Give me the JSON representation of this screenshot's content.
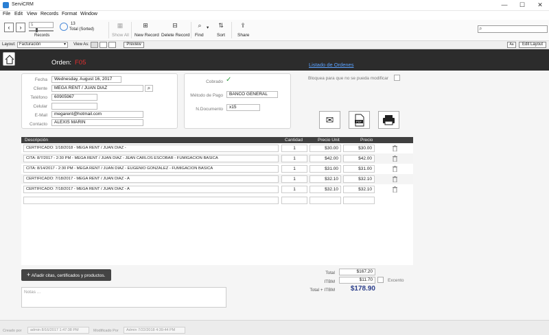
{
  "window": {
    "title": "ServiCRM",
    "minimize": "—",
    "maximize": "☐",
    "close": "✕"
  },
  "menu": [
    "File",
    "Edit",
    "View",
    "Records",
    "Format",
    "Window"
  ],
  "toolbar": {
    "record_value": "5",
    "records_label": "Records",
    "found_count": "13",
    "found_label": "Total (Sorted)",
    "show_all": "Show All",
    "new_record": "New Record",
    "delete_record": "Delete Record",
    "find": "Find",
    "sort": "Sort",
    "share": "Share"
  },
  "layoutbar": {
    "layout_label": "Layout:",
    "layout_value": "Facturación",
    "view_as_label": "View As:",
    "preview": "Preview",
    "aa": "Aa",
    "edit_layout": "Edit Layout"
  },
  "header": {
    "orden_label": "Orden:",
    "orden_value": "F05",
    "listado_link": "Listado  de Ordenes"
  },
  "client": {
    "fecha_label": "Fecha",
    "fecha": "Wednesday, August 16, 2017",
    "cliente_label": "Cliente",
    "cliente": "MEGA RENT / JUAN DIAZ",
    "telefono_label": "Teléfono",
    "telefono": "60905967",
    "celular_label": "Celular",
    "celular": "",
    "email_label": "E-Mail",
    "email": "megarent@hotmail.com",
    "contacto_label": "Contacto",
    "contacto": "ALEXIS MARIN"
  },
  "payment": {
    "cobrado_label": "Cobrado",
    "metodo_label": "Método de Pago",
    "metodo": "BANCO GENERAL",
    "documento_label": "N.Documento",
    "documento": "x15"
  },
  "lock_label": "Bloquea para que no se pueda modificar",
  "table": {
    "headers": {
      "descripcion": "Descripción",
      "cantidad": "Cantidad",
      "precio_unit": "Precio Unit",
      "precio": "Precio"
    },
    "rows": [
      {
        "descripcion": "CERTIFICADO:  1/18/2018 - MEGA RENT / JUAN DIAZ -",
        "cantidad": "1",
        "precio_unit": "$30.00",
        "precio": "$30.00"
      },
      {
        "descripcion": "CITA:  8/7/2017 - 2:30 PM - MEGA RENT / JUAN DIAZ - JEAN CARLOS ESCOBAR - FUMIGACION BASICA",
        "cantidad": "1",
        "precio_unit": "$42.00",
        "precio": "$42.00"
      },
      {
        "descripcion": "CITA:  8/14/2017 - 2:30 PM - MEGA RENT / JUAN DIAZ - EUGENIO GONZALEZ - FUMIGACION BASICA",
        "cantidad": "1",
        "precio_unit": "$31.00",
        "precio": "$31.00"
      },
      {
        "descripcion": "CERTIFICADO:  7/18/2017 - MEGA RENT / JUAN DIAZ - A",
        "cantidad": "1",
        "precio_unit": "$32.10",
        "precio": "$32.10"
      },
      {
        "descripcion": "CERTIFICADO:  7/18/2017 - MEGA RENT / JUAN DIAZ - A",
        "cantidad": "1",
        "precio_unit": "$32.10",
        "precio": "$32.10"
      }
    ]
  },
  "add_button": "Añadir citas, certificados y productos.",
  "notas_placeholder": "Notas ...",
  "totals": {
    "total_label": "Total",
    "total": "$167.20",
    "itbm_label": "ITBM",
    "itbm": "$11.70",
    "excento_label": "Excento",
    "grand_label": "Total + ITBM",
    "grand": "$178.90"
  },
  "footer": {
    "creado_label": "Creado por",
    "creado": "admin  8/16/2017 1:47:38 PM",
    "modificado_label": "Modificado Por",
    "modificado": "Admin  7/22/2018 4:39:44 PM"
  },
  "colors": {
    "header_dark": "#2c2c2c",
    "orden_red": "#e03030",
    "link_blue": "#5aa2ff",
    "grand_total": "#2b3e8a",
    "check_green": "#2a9a3a"
  }
}
